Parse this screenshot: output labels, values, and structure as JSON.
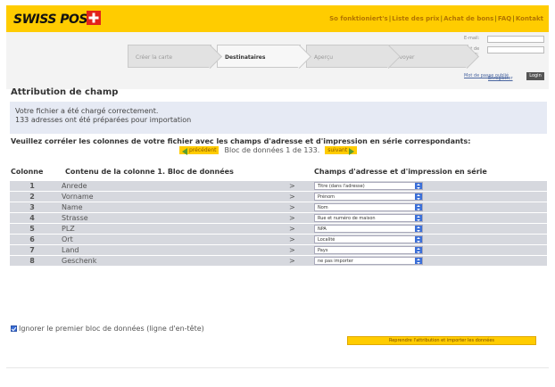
{
  "header": {
    "logo": "SWISS POST",
    "links": [
      "So fonktioniert's",
      "Liste des prix",
      "Achat de bons",
      "FAQ",
      "Kontakt"
    ]
  },
  "steps": [
    "Créer la carte",
    "Destinataires",
    "Aperçu",
    "Envoyer"
  ],
  "active_step": 1,
  "login": {
    "email_label": "E-mail:",
    "password_label": "Mot de passe:",
    "forgot": "Mot de passe oublié",
    "login_button": "Login",
    "register": "Enregistrer"
  },
  "page_title": "Attribution de champ",
  "info": {
    "line1": "Votre fichier a été chargé correctement.",
    "line2": "133 adresses ont été préparées pour importation"
  },
  "instruction": "Veuillez corréler les colonnes de votre fichier avec les champs d'adresse et d'impression en série correspondants:",
  "navigation": {
    "prev": "précédent",
    "bloc_text": "Bloc de données 1 de 133.",
    "next": "suivant"
  },
  "columns": {
    "colonne": "Colonne",
    "contenu": "Contenu de la colonne 1. Bloc de données",
    "champs": "Champs d'adresse et d'impression en série"
  },
  "rows": [
    {
      "num": "1",
      "content": "Anrede",
      "arrow": ">",
      "field": "Titre (dans l'adresse)"
    },
    {
      "num": "2",
      "content": "Vorname",
      "arrow": ">",
      "field": "Prénom"
    },
    {
      "num": "3",
      "content": "Name",
      "arrow": ">",
      "field": "Nom"
    },
    {
      "num": "4",
      "content": "Strasse",
      "arrow": ">",
      "field": "Rue et numéro de maison"
    },
    {
      "num": "5",
      "content": "PLZ",
      "arrow": ">",
      "field": "NPA"
    },
    {
      "num": "6",
      "content": "Ort",
      "arrow": ">",
      "field": "Localité"
    },
    {
      "num": "7",
      "content": "Land",
      "arrow": ">",
      "field": "Pays"
    },
    {
      "num": "8",
      "content": "Geschenk",
      "arrow": ">",
      "field": "ne pas importer"
    }
  ],
  "ignore_label": "Ignorer le premier bloc de données (ligne d'en-tête)",
  "ignore_checked": true,
  "submit": "Reprendre l'attribution et importer les données",
  "colors": {
    "brand": "#ffcc00",
    "info_bg": "#e6eaf4",
    "row_bg": "#d6d8de",
    "select_accent": "#3b6fd8",
    "arrow_green": "#5a9e2e"
  }
}
